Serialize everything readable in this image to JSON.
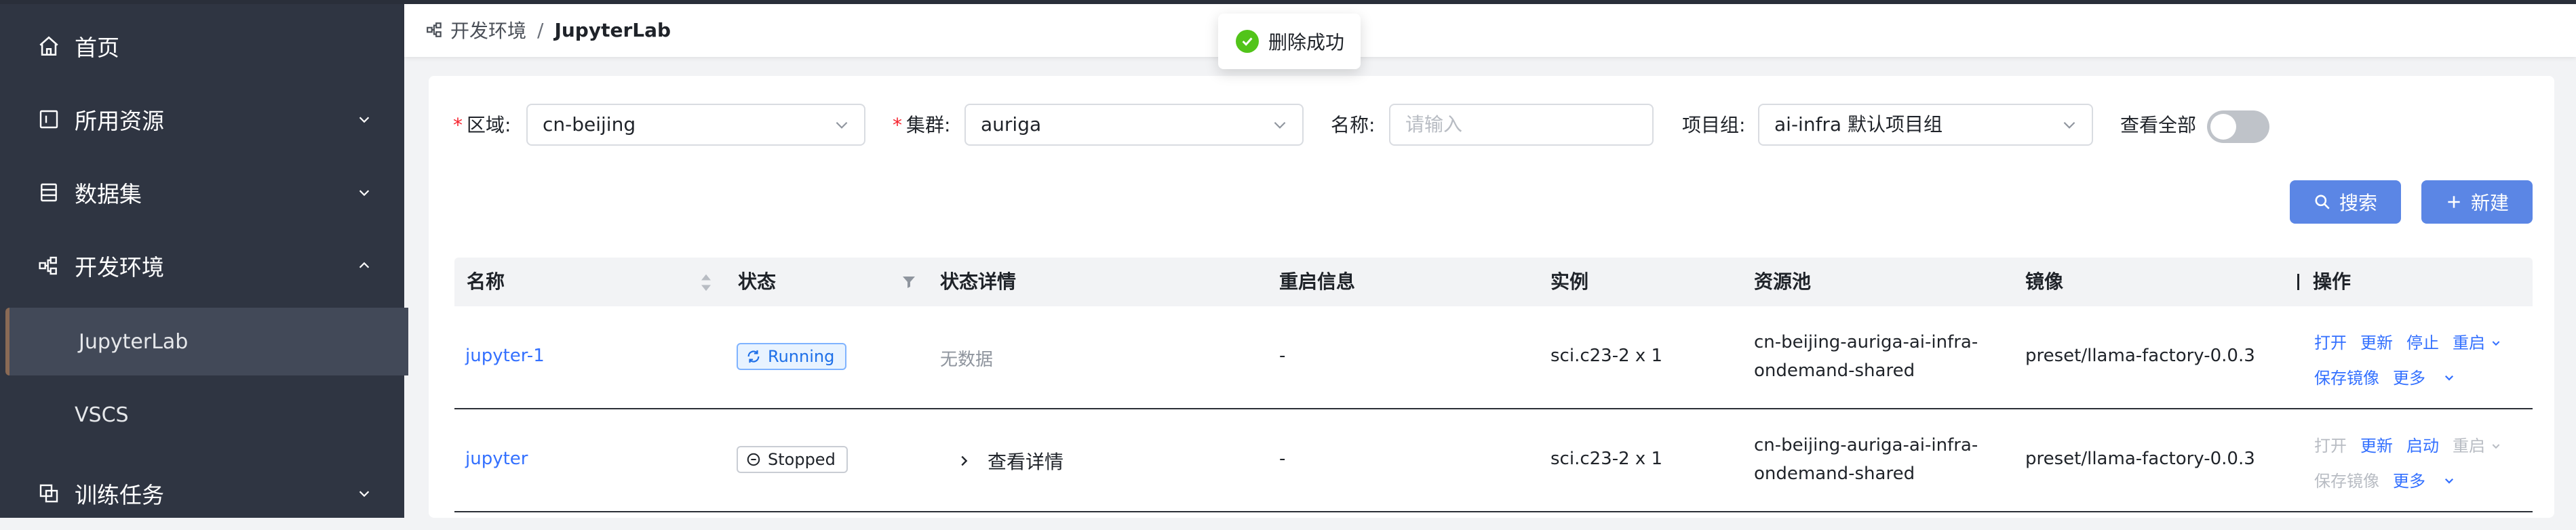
{
  "sidebar": {
    "items": [
      {
        "label": "首页",
        "icon": "home-icon"
      },
      {
        "label": "所用资源",
        "icon": "resource-icon"
      },
      {
        "label": "数据集",
        "icon": "dataset-icon"
      },
      {
        "label": "开发环境",
        "icon": "dev-env-icon"
      },
      {
        "label": "训练任务",
        "icon": "training-icon"
      }
    ],
    "sub_items": [
      {
        "label": "JupyterLab",
        "active": true
      },
      {
        "label": "VSCS",
        "active": false
      }
    ]
  },
  "header": {
    "breadcrumb_root": "开发环境",
    "breadcrumb_sep": "/",
    "breadcrumb_current": "JupyterLab"
  },
  "toast": {
    "message": "删除成功"
  },
  "filters": {
    "region_label": "区域",
    "region_value": "cn-beijing",
    "cluster_label": "集群",
    "cluster_value": "auriga",
    "name_label": "名称",
    "name_placeholder": "请输入",
    "project_label": "项目组",
    "project_value": "ai-infra 默认项目组",
    "view_all_label": "查看全部",
    "view_all_on": false
  },
  "actions": {
    "search": "搜索",
    "create": "新建"
  },
  "table": {
    "columns": [
      "名称",
      "状态",
      "状态详情",
      "重启信息",
      "实例",
      "资源池",
      "镜像",
      "操作"
    ],
    "rows": [
      {
        "name": "jupyter-1",
        "status": "Running",
        "detail": "无数据",
        "restart": "-",
        "instance": "sci.c23-2 x 1",
        "pool_line1": "cn-beijing-auriga-ai-infra-",
        "pool_line2": "ondemand-shared",
        "image": "preset/llama-factory-0.0.3",
        "ops": {
          "open": "打开",
          "update": "更新",
          "stop": "停止",
          "restart": "重启",
          "save_image": "保存镜像",
          "more": "更多"
        }
      },
      {
        "name": "jupyter",
        "status": "Stopped",
        "detail": "查看详情",
        "restart": "-",
        "instance": "sci.c23-2 x 1",
        "pool_line1": "cn-beijing-auriga-ai-infra-",
        "pool_line2": "ondemand-shared",
        "image": "preset/llama-factory-0.0.3",
        "ops": {
          "open": "打开",
          "update": "更新",
          "start": "启动",
          "restart": "重启",
          "save_image": "保存镜像",
          "more": "更多"
        }
      }
    ]
  },
  "colors": {
    "sidebar": "#2f3542",
    "primary_button": "#5b86e5",
    "link": "#3370ff",
    "success": "#52c41a"
  }
}
